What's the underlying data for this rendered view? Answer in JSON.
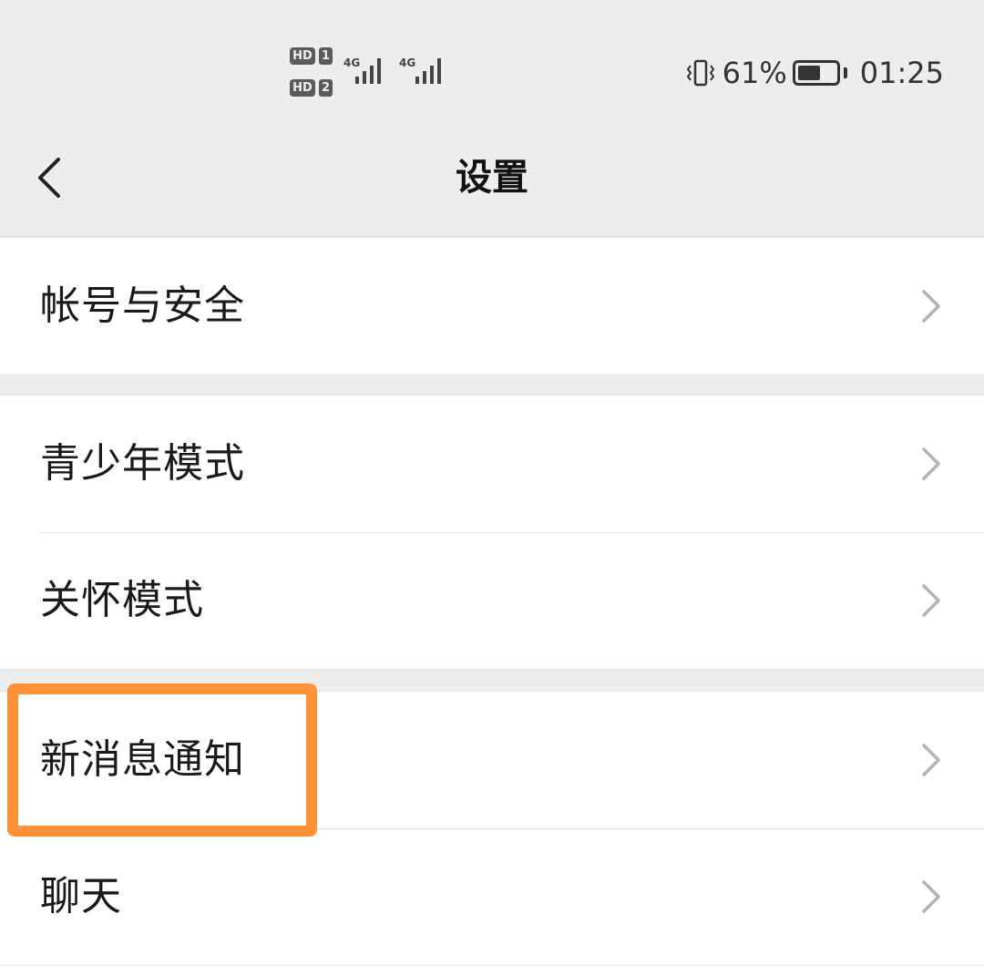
{
  "status_bar": {
    "sim1": {
      "hd": "HD",
      "slot": "1",
      "network": "4G"
    },
    "sim2": {
      "hd": "HD",
      "slot": "2",
      "network": "4G"
    },
    "vibrate_icon": "vibrate-icon",
    "battery_percent": "61%",
    "battery_level": 0.61,
    "time": "01:25"
  },
  "nav": {
    "back_icon": "chevron-left-icon",
    "title": "设置"
  },
  "groups": [
    {
      "items": [
        {
          "label": "帐号与安全"
        }
      ]
    },
    {
      "items": [
        {
          "label": "青少年模式"
        },
        {
          "label": "关怀模式"
        }
      ]
    },
    {
      "items": [
        {
          "label": "新消息通知"
        },
        {
          "label": "聊天"
        }
      ]
    }
  ],
  "highlight": {
    "color": "#ff9137",
    "target": "新消息通知"
  }
}
